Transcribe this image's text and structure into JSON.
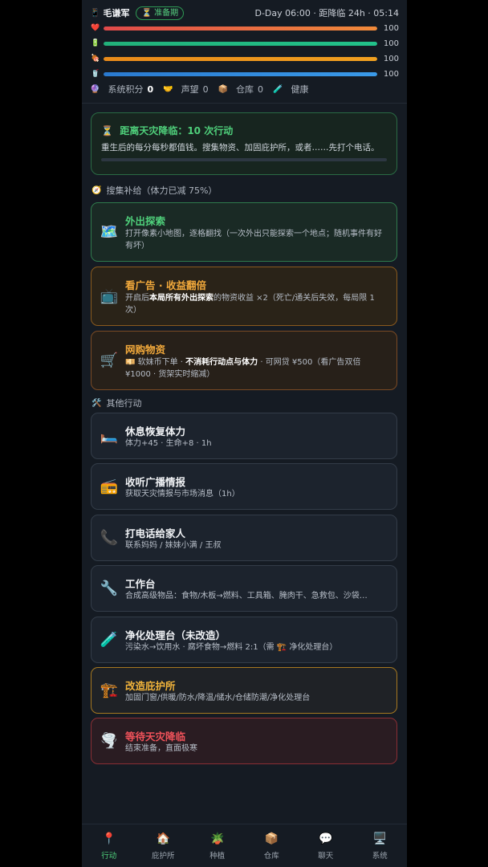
{
  "header": {
    "phone_icon": "phone-icon",
    "name": "毛谦军",
    "badge": "准备期",
    "dday": "D-Day 06:00 · 距降临 24h · 05:14",
    "bars": [
      {
        "icon": "heart-icon",
        "glyph": "❤️",
        "value": "100",
        "percent": 100,
        "color_from": "#e04a4a",
        "color_to": "#f08a3a"
      },
      {
        "icon": "battery-icon",
        "glyph": "🔋",
        "value": "100",
        "percent": 100,
        "color_from": "#22b07a",
        "color_to": "#22c28a"
      },
      {
        "icon": "food-icon",
        "glyph": "🍖",
        "value": "100",
        "percent": 100,
        "color_from": "#e88a1a",
        "color_to": "#f0a020"
      },
      {
        "icon": "water-icon",
        "glyph": "🥤",
        "value": "100",
        "percent": 100,
        "color_from": "#2a7ad0",
        "color_to": "#3a9ae8"
      }
    ],
    "stats": {
      "score_label": "系统积分",
      "score_value": "0",
      "reputation_label": "声望",
      "reputation_value": "0",
      "storage_label": "仓库",
      "storage_value": "0",
      "health_label": "健康"
    }
  },
  "banner": {
    "title": "距离天灾降临：10 次行动",
    "subtitle": "重生后的每分每秒都值钱。搜集物资、加固庇护所，或者……先打个电话。",
    "progress": 0
  },
  "section_gather": "搜集补给（体力已减 75%）",
  "section_other": "其他行动",
  "cards": {
    "explore": {
      "title": "外出探索",
      "desc": "打开像素小地图，逐格翻找（一次外出只能探索一个地点；随机事件有好有坏）"
    },
    "ads": {
      "title": "看广告 · 收益翻倍",
      "desc_pre": "开启后",
      "desc_bold": "本局所有外出探索",
      "desc_post": "的物资收益 ×2（死亡/通关后失效，每局限 1 次）"
    },
    "shop": {
      "title": "网购物资",
      "desc_pre": "💴 软妹币下单 · ",
      "desc_bold": "不消耗行动点与体力",
      "desc_post": " · 可网贷 ¥500（看广告双倍 ¥1000 · 货架实时缩减）"
    },
    "rest": {
      "title": "休息恢复体力",
      "desc": "体力+45 · 生命+8 · 1h"
    },
    "radio": {
      "title": "收听广播情报",
      "desc": "获取天灾情报与市场消息（1h）"
    },
    "call": {
      "title": "打电话给家人",
      "desc": "联系妈妈 / 妹妹小满 / 王叔"
    },
    "workbench": {
      "title": "工作台",
      "desc": "合成高级物品：食物/木板→燃料、工具箱、腌肉干、急救包、沙袋…"
    },
    "purifier": {
      "title": "净化处理台（未改造）",
      "desc": "污染水→饮用水 · 腐坏食物→燃料 2:1（需 🏗️ 净化处理台）"
    },
    "renovate": {
      "title": "改造庇护所",
      "desc": "加固门窗/供暖/防水/降温/储水/仓储防潮/净化处理台"
    },
    "wait": {
      "title": "等待天灾降临",
      "desc": "结束准备，直面极寒"
    }
  },
  "nav": [
    {
      "label": "行动",
      "icon": "pin-icon",
      "glyph": "📍",
      "active": true
    },
    {
      "label": "庇护所",
      "icon": "house-icon",
      "glyph": "🏠",
      "active": false
    },
    {
      "label": "种植",
      "icon": "plant-icon",
      "glyph": "🪴",
      "active": false
    },
    {
      "label": "仓库",
      "icon": "box-icon",
      "glyph": "📦",
      "active": false
    },
    {
      "label": "聊天",
      "icon": "chat-icon",
      "glyph": "💬",
      "active": false
    },
    {
      "label": "系统",
      "icon": "monitor-icon",
      "glyph": "🖥️",
      "active": false
    }
  ]
}
